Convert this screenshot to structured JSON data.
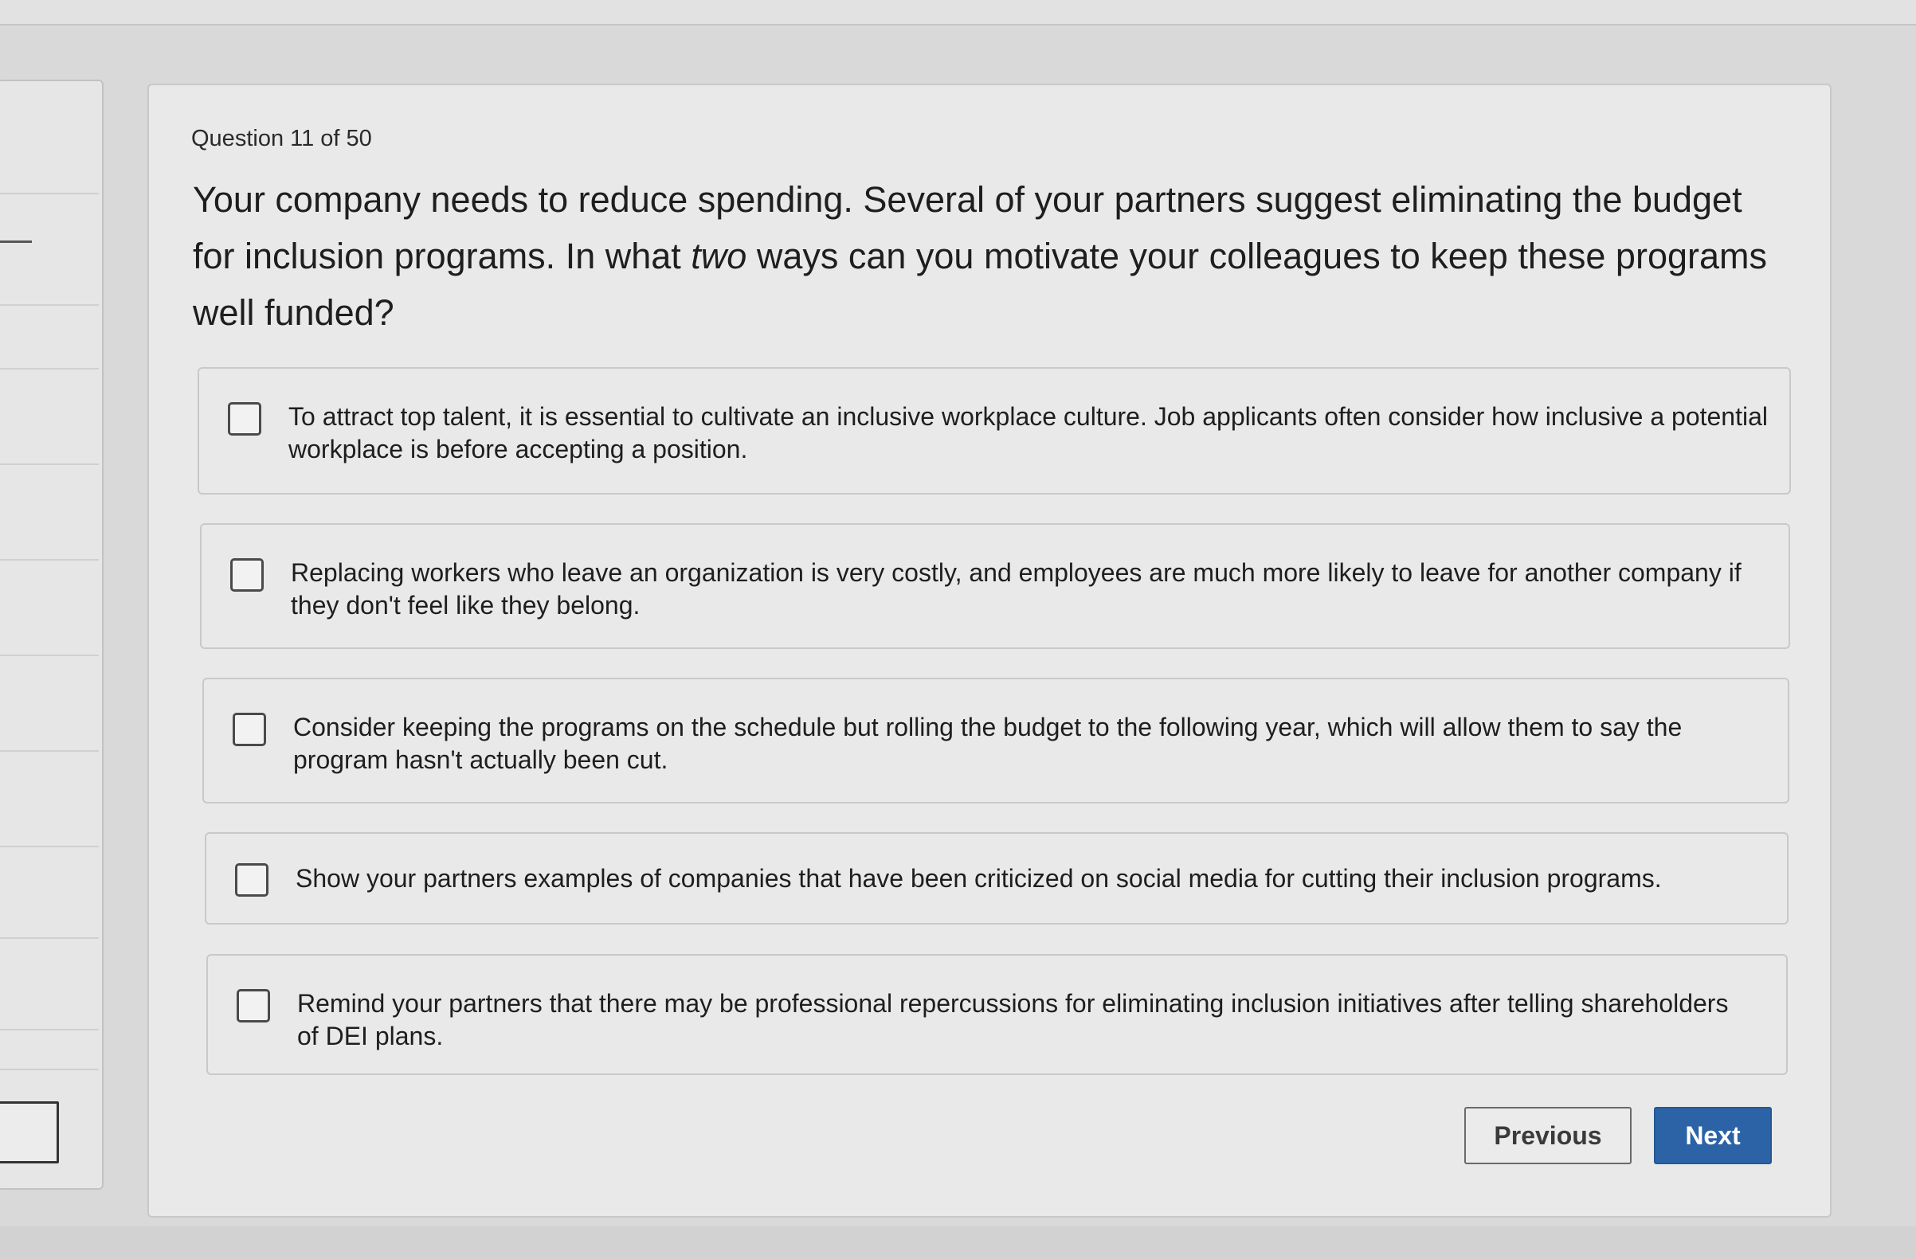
{
  "question": {
    "counter": "Question 11 of 50",
    "text_before": "Your company needs to reduce spending. Several of your partners suggest eliminating the budget for inclusion programs. In what ",
    "text_emphasis": "two",
    "text_after": " ways can you motivate your colleagues to keep these programs well funded?"
  },
  "options": [
    {
      "label": "To attract top talent, it is essential to cultivate an inclusive workplace culture. Job applicants often consider how inclusive a potential workplace is before accepting a position.",
      "checked": false
    },
    {
      "label": "Replacing workers who leave an organization is very costly, and employees are much more likely to leave for another company if they don't feel like they belong.",
      "checked": false
    },
    {
      "label": "Consider keeping the programs on the schedule but rolling the budget to the following year, which will allow them to say the program hasn't actually been cut.",
      "checked": false
    },
    {
      "label": "Show your partners examples of companies that have been criticized on social media for cutting their inclusion programs.",
      "checked": false
    },
    {
      "label": "Remind your partners that there may be professional repercussions for eliminating inclusion initiatives after telling shareholders of DEI plans.",
      "checked": false
    }
  ],
  "navigation": {
    "previous_label": "Previous",
    "next_label": "Next"
  },
  "colors": {
    "primary_button": "#2b63a6",
    "background": "#d9d9d9",
    "card": "#e9e9e9"
  }
}
